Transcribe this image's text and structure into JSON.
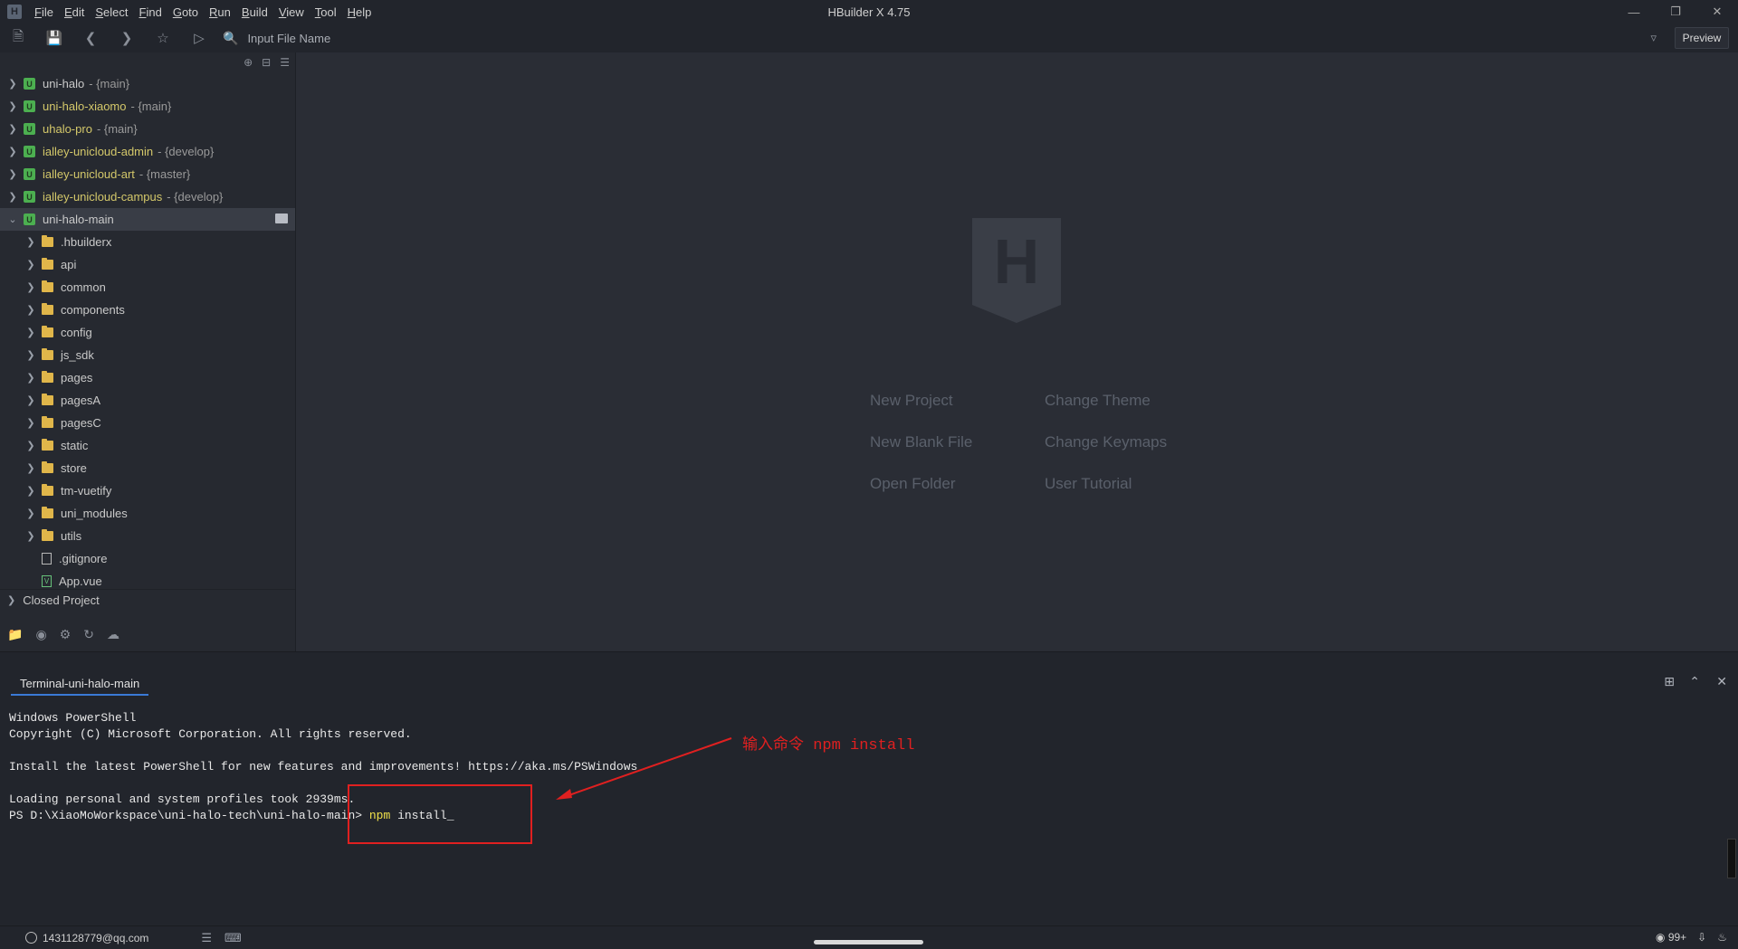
{
  "window": {
    "title": "HBuilder X 4.75",
    "logo": "H"
  },
  "menu": [
    {
      "label": "File",
      "key": "F"
    },
    {
      "label": "Edit",
      "key": "E"
    },
    {
      "label": "Select",
      "key": "S"
    },
    {
      "label": "Find",
      "key": "F"
    },
    {
      "label": "Goto",
      "key": "G"
    },
    {
      "label": "Run",
      "key": "R"
    },
    {
      "label": "Build",
      "key": "B"
    },
    {
      "label": "View",
      "key": "V"
    },
    {
      "label": "Tool",
      "key": "T"
    },
    {
      "label": "Help",
      "key": "H"
    }
  ],
  "toolbar": {
    "search_placeholder": "Input File Name",
    "preview_label": "Preview"
  },
  "sidebar": {
    "projects": [
      {
        "name": "uni-halo",
        "branch": "- {main}"
      },
      {
        "name": "uni-halo-xiaomo",
        "branch": "- {main}"
      },
      {
        "name": "uhalo-pro",
        "branch": "- {main}"
      },
      {
        "name": "ialley-unicloud-admin",
        "branch": "- {develop}"
      },
      {
        "name": "ialley-unicloud-art",
        "branch": "- {master}"
      },
      {
        "name": "ialley-unicloud-campus",
        "branch": "- {develop}"
      }
    ],
    "open_project": "uni-halo-main",
    "folders": [
      "hbuilderx",
      "api",
      "common",
      "components",
      "config",
      "js_sdk",
      "pages",
      "pagesA",
      "pagesC",
      "static",
      "store",
      "tm-vuetify",
      "uni_modules",
      "utils"
    ],
    "folders_display": [
      ".hbuilderx",
      "api",
      "common",
      "components",
      "config",
      "js_sdk",
      "pages",
      "pagesA",
      "pagesC",
      "static",
      "store",
      "tm-vuetify",
      "uni_modules",
      "utils"
    ],
    "files": [
      ".gitignore",
      "App.vue"
    ],
    "closed_project": "Closed Project"
  },
  "welcome": {
    "logo_letter": "H",
    "links": {
      "new_project": "New Project",
      "change_theme": "Change Theme",
      "new_blank_file": "New Blank File",
      "change_keymaps": "Change Keymaps",
      "open_folder": "Open Folder",
      "user_tutorial": "User Tutorial"
    }
  },
  "terminal": {
    "tab": "Terminal-uni-halo-main",
    "lines": [
      "Windows PowerShell",
      "Copyright (C) Microsoft Corporation. All rights reserved.",
      "",
      "Install the latest PowerShell for new features and improvements! https://aka.ms/PSWindows",
      "",
      "Loading personal and system profiles took 2939ms."
    ],
    "prompt": "PS D:\\XiaoMoWorkspace\\uni-halo-tech\\uni-halo-main> ",
    "command": "npm",
    "args": " install_"
  },
  "annotation": {
    "text": "输入命令 npm install",
    "color": "#e02020"
  },
  "status": {
    "account": "1431128779@qq.com",
    "notifications": "99+"
  },
  "colors": {
    "accent": "#3a7ad6",
    "project_badge": "#4caf50",
    "folder": "#e0b64a"
  }
}
